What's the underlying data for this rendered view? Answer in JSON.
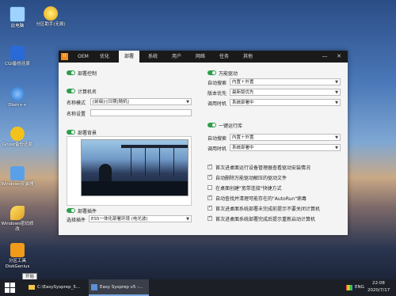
{
  "desktop": {
    "icons": [
      {
        "label": "此电脑",
        "color": "#9fd3ff"
      },
      {
        "label": "分区助手(无损)",
        "color": "#ffcf33"
      },
      {
        "label": "CGI备份还原",
        "color": "#2a6ad8"
      },
      {
        "label": "Dism++",
        "color": "#3b8fe2"
      },
      {
        "label": "Ghost备份还原",
        "color": "#f2c21b"
      },
      {
        "label": "Windows安装器",
        "color": "#5aa0e8"
      },
      {
        "label": "Windows密码修改",
        "color": "#e8b92a"
      },
      {
        "label": "分区工具DiskGenius",
        "color": "#f29a1a"
      }
    ],
    "start_tooltip": "开始"
  },
  "window": {
    "title_icon": "II",
    "tabs": [
      "OEM",
      "优化",
      "部署",
      "系统",
      "用户",
      "网络",
      "任务",
      "其他"
    ],
    "active_tab": "部署",
    "minimize": "—",
    "close": "✕",
    "left": {
      "deploy_control": "部署控制",
      "computer_name": {
        "title": "计算机名",
        "mode_label": "名称模式",
        "mode_value": "[前缀]-[日期]随机]",
        "setting_label": "名称设置",
        "setting_value": ""
      },
      "background": {
        "title": "部署背景"
      },
      "plugin": {
        "title": "部署插件",
        "select_label": "选择插件",
        "select_value": "ES5一体化部署环境 (电光波)"
      }
    },
    "right": {
      "driver": {
        "title": "万能驱动",
        "rows": [
          {
            "label": "自动搜索",
            "value": "内置＋外置"
          },
          {
            "label": "版本优先",
            "value": "最新版优先"
          },
          {
            "label": "调用时机",
            "value": "系统部署中"
          }
        ]
      },
      "runtime": {
        "title": "一键运行库",
        "rows": [
          {
            "label": "自动搜索",
            "value": "内置＋外置"
          },
          {
            "label": "调用时机",
            "value": "系统部署中"
          }
        ]
      },
      "checks": [
        {
          "label": "首次进桌面运行设备管理器查看驱动安装情况",
          "checked": true
        },
        {
          "label": "自动删除万能驱动解压的驱动文件",
          "checked": true
        },
        {
          "label": "在桌面创建\"宽带连接\"快捷方式",
          "checked": false
        },
        {
          "label": "自动查找并清理可能存在的\"AutoRun\"病毒",
          "checked": true
        },
        {
          "label": "首次进桌面系统部署未完成前提示不要关闭计算机",
          "checked": true
        },
        {
          "label": "首次进桌面系统部署完成后提示重新启动计算机",
          "checked": true
        }
      ]
    }
  },
  "taskbar": {
    "start_icon": "windows-logo",
    "items": [
      {
        "label": "C:\\EasySysprep_5..."
      },
      {
        "label": "Easy Sysprep v5 -..."
      }
    ],
    "lang": "ENG",
    "time": "22:08",
    "date": "2020/7/17"
  },
  "colors": {
    "toggle_on": "#2e9e4a",
    "titlebar": "#1a1a1a",
    "taskbar": "#1c1f26"
  }
}
